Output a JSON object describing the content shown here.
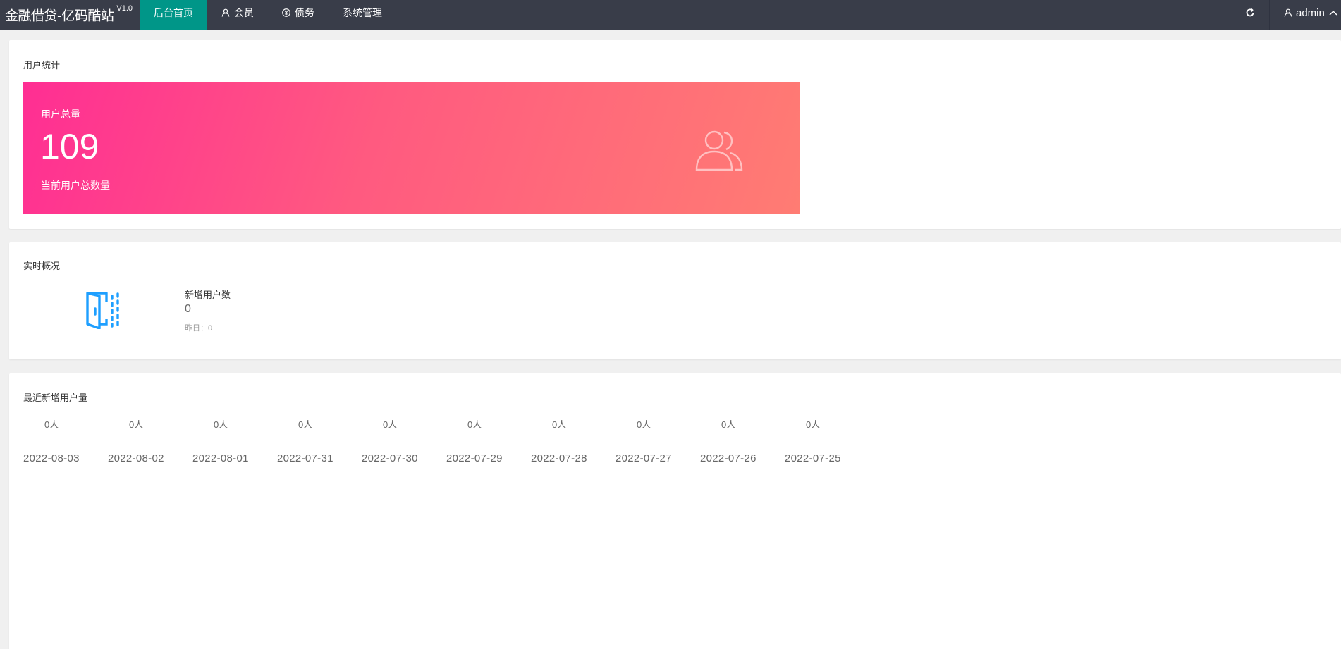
{
  "header": {
    "logo": "金融借贷-亿码酷站",
    "version": "V1.0",
    "nav": [
      {
        "label": "后台首页"
      },
      {
        "label": "会员"
      },
      {
        "label": "债务"
      },
      {
        "label": "系统管理"
      }
    ],
    "user": "admin"
  },
  "stats": {
    "title": "用户统计",
    "label": "用户总量",
    "value": "109",
    "desc": "当前用户总数量",
    "icon": "users-icon"
  },
  "realtime": {
    "title": "实时概况",
    "label": "新增用户数",
    "value": "0",
    "yesterday": "昨日：0",
    "icon": "door-icon"
  },
  "recent": {
    "title": "最近新增用户量",
    "items": [
      {
        "count": "0人",
        "date": "2022-08-03"
      },
      {
        "count": "0人",
        "date": "2022-08-02"
      },
      {
        "count": "0人",
        "date": "2022-08-01"
      },
      {
        "count": "0人",
        "date": "2022-07-31"
      },
      {
        "count": "0人",
        "date": "2022-07-30"
      },
      {
        "count": "0人",
        "date": "2022-07-29"
      },
      {
        "count": "0人",
        "date": "2022-07-28"
      },
      {
        "count": "0人",
        "date": "2022-07-27"
      },
      {
        "count": "0人",
        "date": "2022-07-26"
      },
      {
        "count": "0人",
        "date": "2022-07-25"
      }
    ]
  },
  "colors": {
    "topbar": "#393d49",
    "active_nav": "#009688",
    "banner_start": "#ff2e93",
    "banner_end": "#ff7c73",
    "accent_blue": "#1e9fff"
  }
}
